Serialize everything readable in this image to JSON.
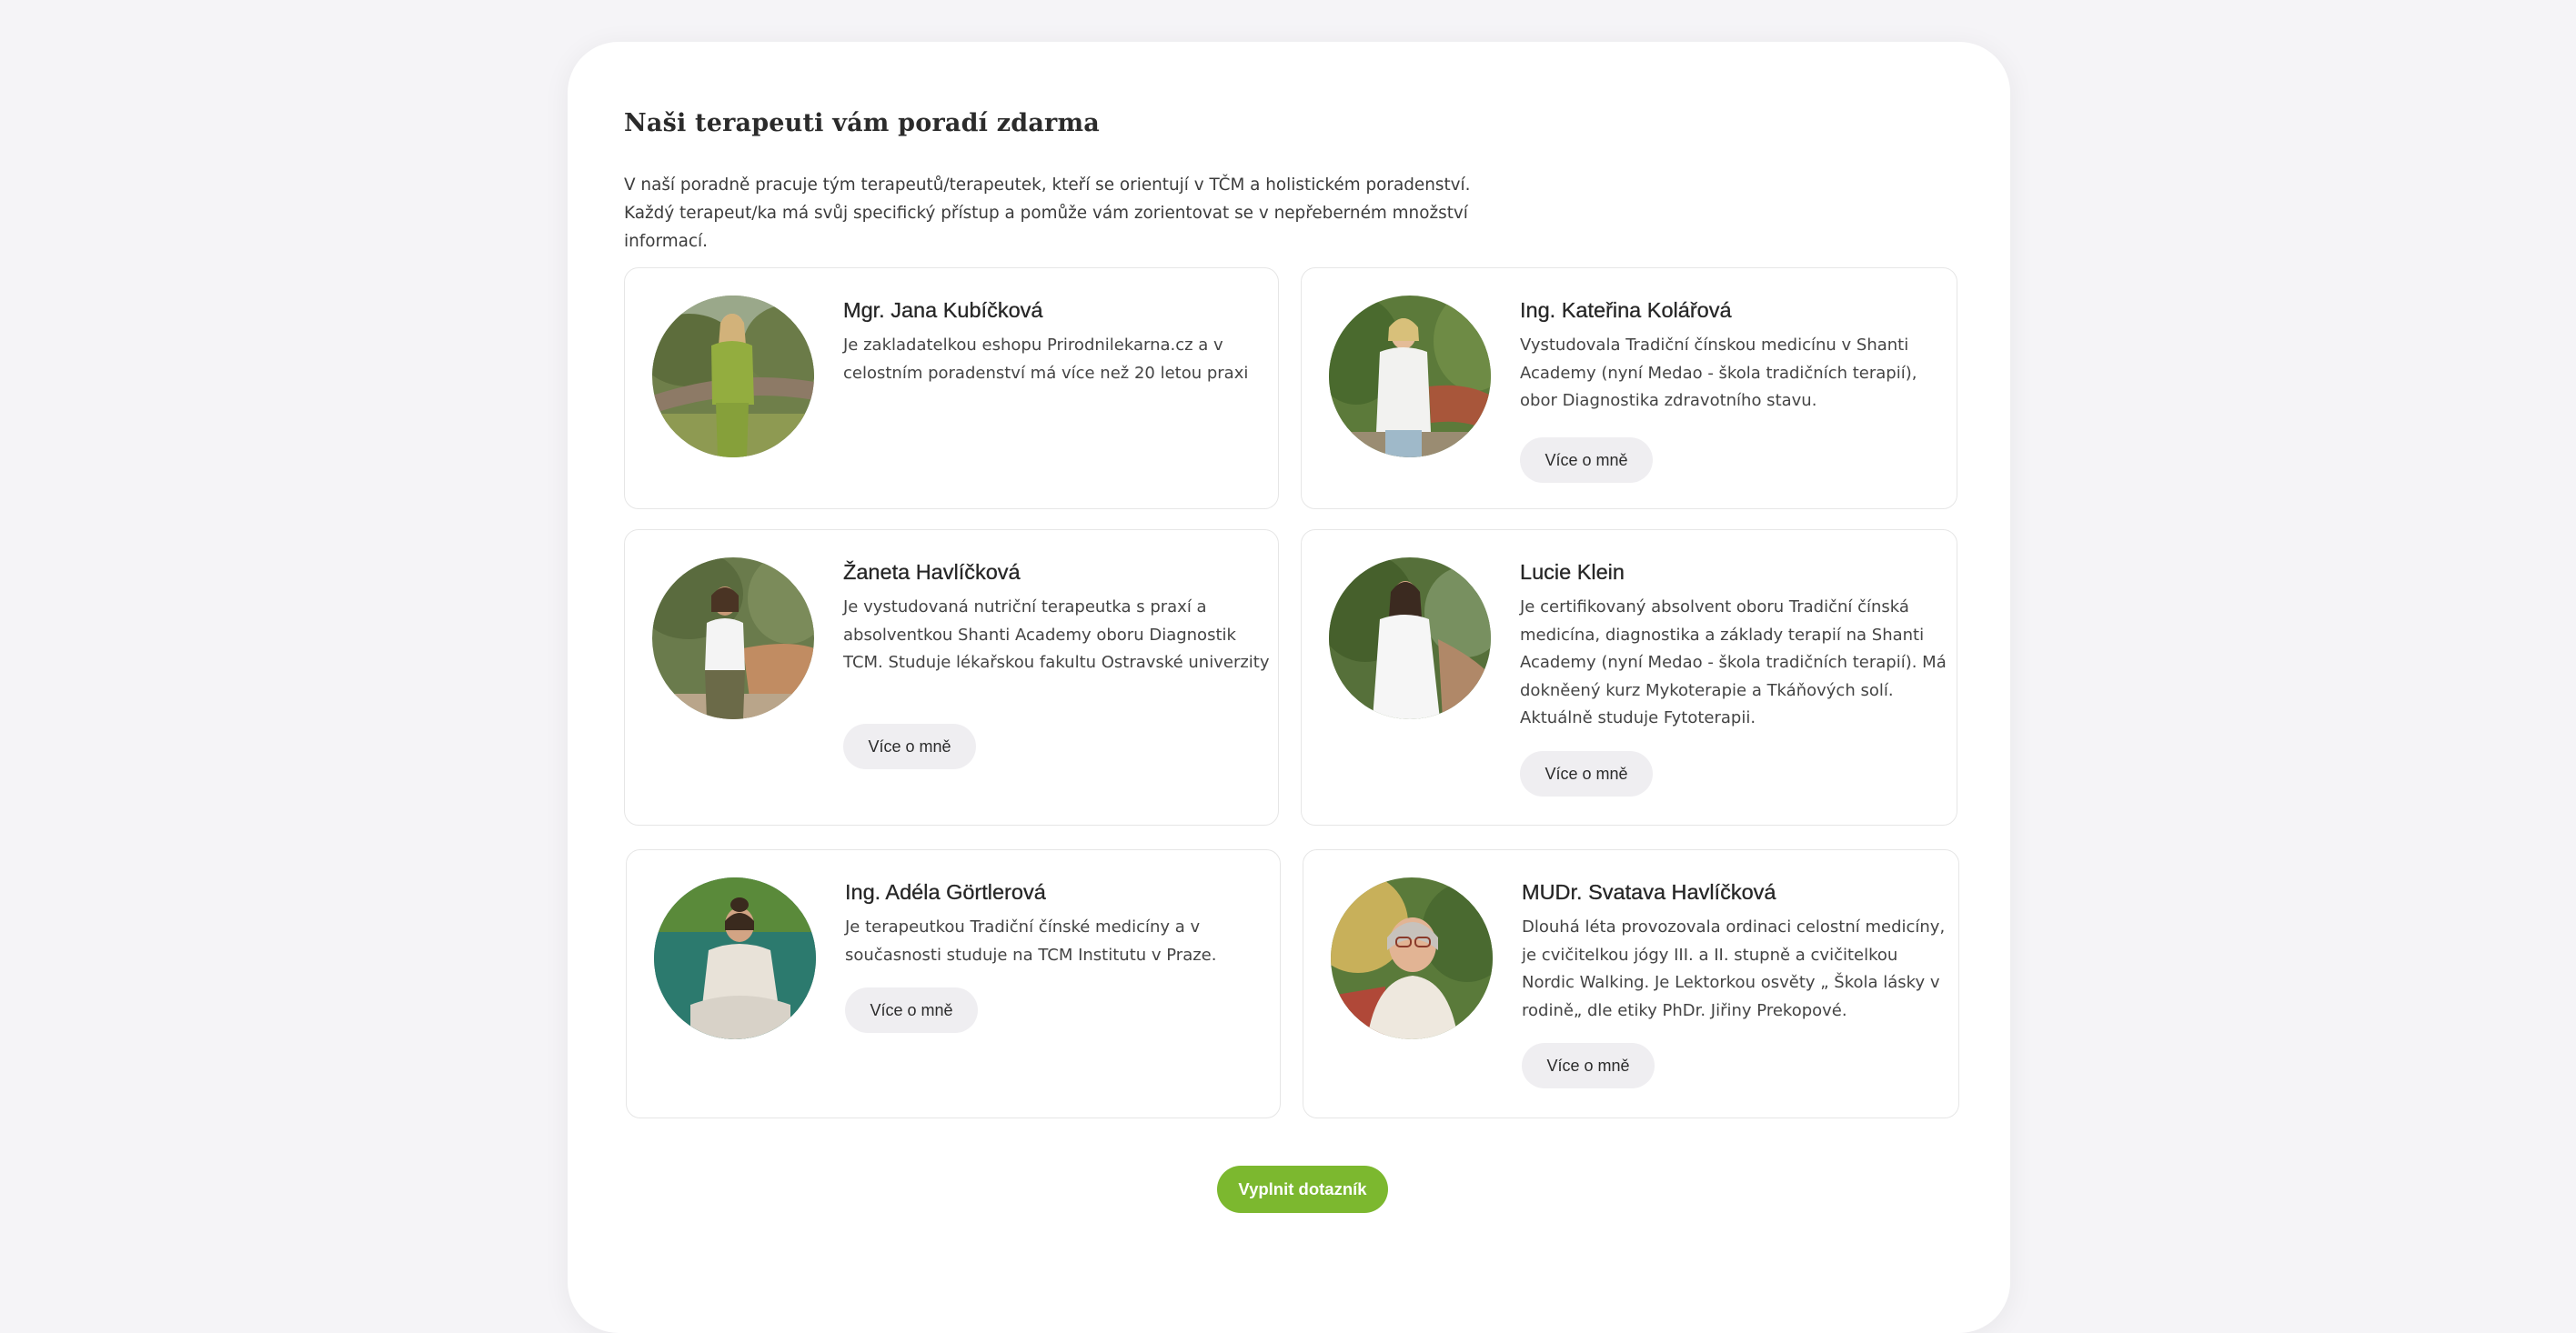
{
  "section": {
    "title": "Naši terapeuti vám poradí zdarma",
    "intro": "V naší poradně pracuje tým terapeutů/terapeutek, kteří se orientují v TČM a holistickém poradenství. Každý terapeut/ka má svůj specifický přístup a pomůže vám zorientovat se v nepřeberném množství informací."
  },
  "therapists": [
    {
      "name": "Mgr. Jana Kubíčková",
      "bio": "Je zakladatelkou eshopu Prirodnilekarna.cz a v celostním poradenství má více než 20 letou praxi"
    },
    {
      "name": "Ing. Kateřina Kolářová",
      "bio": "Vystudovala Tradiční čínskou medicínu v Shanti Academy (nyní Medao - škola tradičních terapií), obor Diagnostika zdravotního stavu.",
      "button": "Více o mně"
    },
    {
      "name": "Žaneta Havlíčková",
      "bio": "Je vystudovaná nutriční terapeutka s praxí a absolventkou Shanti Academy oboru Diagnostik TCM. Studuje lékařskou fakultu Ostravské univerzity",
      "button": "Více o mně"
    },
    {
      "name": "Lucie Klein",
      "bio": "Je certifikovaný absolvent oboru Tradiční čínská medicína, diagnostika a základy terapií na Shanti Academy (nyní Medao - škola tradičních terapií). Má dokněený kurz Mykoterapie a Tkáňových solí. Aktuálně studuje Fytoterapii.",
      "button": "Více o mně"
    },
    {
      "name": "Ing. Adéla Görtlerová",
      "bio": "Je terapeutkou Tradiční čínské medicíny a v současnosti studuje na TCM Institutu v Praze.",
      "button": "Více o mně"
    },
    {
      "name": "MUDr. Svatava Havlíčková",
      "bio": "Dlouhá léta provozovala ordinaci celostní medicíny, je cvičitelkou jógy III. a II. stupně a cvičitelkou Nordic Walking. Je Lektorkou osvěty „ Škola lásky v rodině„  dle etiky PhDr. Jiřiny Prekopové.",
      "button": "Více o mně"
    }
  ],
  "cta": {
    "label": "Vyplnit dotazník",
    "color": "#7cb82f"
  }
}
